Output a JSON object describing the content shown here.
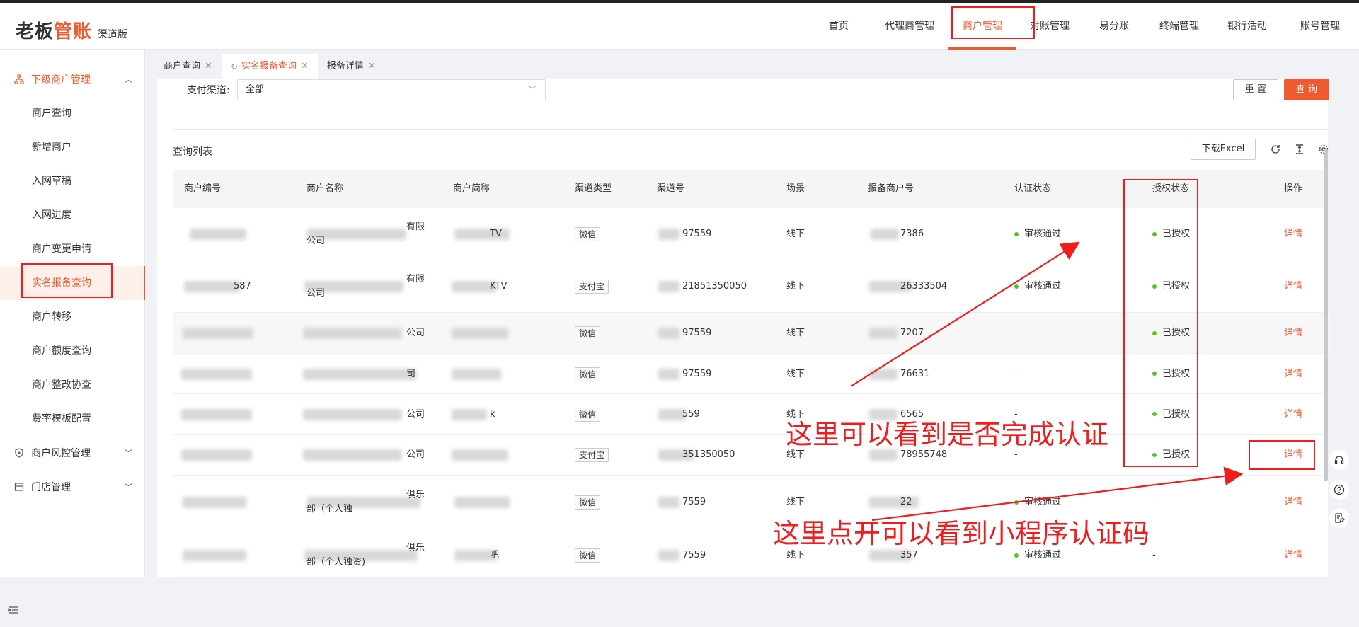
{
  "logo": {
    "part1": "老板",
    "part2": "管账",
    "edition": "渠道版"
  },
  "topnav": [
    "首页",
    "代理商管理",
    "商户管理",
    "对账管理",
    "易分账",
    "终端管理",
    "银行活动",
    "账号管理"
  ],
  "sidebar": {
    "group1": "下级商户管理",
    "items": [
      "商户查询",
      "新增商户",
      "入网草稿",
      "入网进度",
      "商户变更申请",
      "实名报备查询",
      "商户转移",
      "商户额度查询",
      "商户整改协查",
      "费率模板配置"
    ],
    "group2": "商户风控管理",
    "group3": "门店管理"
  },
  "tabs": [
    "商户查询",
    "实名报备查询",
    "报备详情"
  ],
  "filter": {
    "label": "支付渠道:",
    "value": "全部",
    "reset": "重 置",
    "query": "查 询"
  },
  "list": {
    "title": "查询列表",
    "excel": "下载Excel"
  },
  "columns": [
    "商户编号",
    "商户名称",
    "商户简称",
    "渠道类型",
    "渠道号",
    "场景",
    "报备商户号",
    "认证状态",
    "授权状态",
    "操作"
  ],
  "rows": [
    {
      "id": "",
      "name": "有限",
      "name2": "公司",
      "short": "TV",
      "channel": "微信",
      "channel_no": "97559",
      "scene": "线下",
      "report_no": "7386",
      "auth": "审核通过",
      "grant": "已授权",
      "op": "详情"
    },
    {
      "id": "587",
      "name": "有限",
      "name2": "公司",
      "short": "KTV",
      "channel": "支付宝",
      "channel_no": "21851350050",
      "scene": "线下",
      "report_no": "26333504",
      "auth": "审核通过",
      "grant": "已授权",
      "op": "详情"
    },
    {
      "id": "",
      "name": "公司",
      "name2": "",
      "short": "",
      "channel": "微信",
      "channel_no": "97559",
      "scene": "线下",
      "report_no": "7207",
      "auth": "-",
      "grant": "已授权",
      "op": "详情"
    },
    {
      "id": "",
      "name": "司",
      "name2": "",
      "short": "",
      "channel": "微信",
      "channel_no": "97559",
      "scene": "线下",
      "report_no": "76631",
      "auth": "-",
      "grant": "已授权",
      "op": "详情"
    },
    {
      "id": "",
      "name": "公司",
      "name2": "",
      "short": "k",
      "channel": "微信",
      "channel_no": "559",
      "scene": "线下",
      "report_no": "6565",
      "auth": "-",
      "grant": "已授权",
      "op": "详情"
    },
    {
      "id": "",
      "name": "公司",
      "name2": "",
      "short": "",
      "channel": "支付宝",
      "channel_no": "351350050",
      "scene": "线下",
      "report_no": "78955748",
      "auth": "-",
      "grant": "已授权",
      "op": "详情"
    },
    {
      "id": "",
      "name": "俱乐",
      "name2": "部（个人独",
      "short": "",
      "channel": "微信",
      "channel_no": "7559",
      "scene": "线下",
      "report_no": "22",
      "auth": "审核通过",
      "grant": "-",
      "op": "详情"
    },
    {
      "id": "",
      "name": "俱乐",
      "name2": "部（个人独资)",
      "short": "吧",
      "channel": "微信",
      "channel_no": "7559",
      "scene": "线下",
      "report_no": "357",
      "auth": "审核通过",
      "grant": "-",
      "op": "详情"
    }
  ],
  "annotations": {
    "line1": "这里可以看到是否完成认证",
    "line2": "这里点开可以看到小程序认证码"
  },
  "colors": {
    "accent": "#f05a30",
    "annotation": "#f21c1c",
    "success": "#52c41a"
  }
}
